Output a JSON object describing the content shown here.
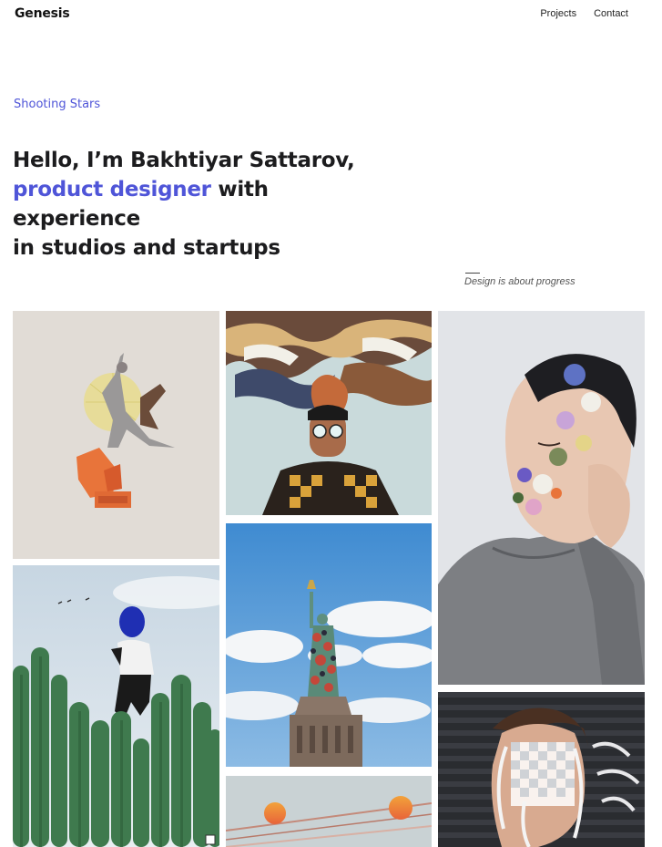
{
  "header": {
    "logo": "Genesis",
    "nav": [
      {
        "label": "Projects"
      },
      {
        "label": "Contact"
      }
    ]
  },
  "hero": {
    "eyebrow": "Shooting Stars",
    "line1": "Hello, I’m Bakhtiyar Sattarov,",
    "accent": "product designer",
    "line2_rest": " with experience",
    "line3": "in studios and startups"
  },
  "motto": "Design is about progress",
  "colors": {
    "accent": "#4f55d8"
  },
  "gallery": [
    {
      "name": "dancer-collage"
    },
    {
      "name": "cactus-balloon"
    },
    {
      "name": "smoke-waves-portrait"
    },
    {
      "name": "statue-of-liberty"
    },
    {
      "name": "orange-spheres"
    },
    {
      "name": "flower-face-portrait"
    },
    {
      "name": "glitch-face-portrait"
    }
  ]
}
